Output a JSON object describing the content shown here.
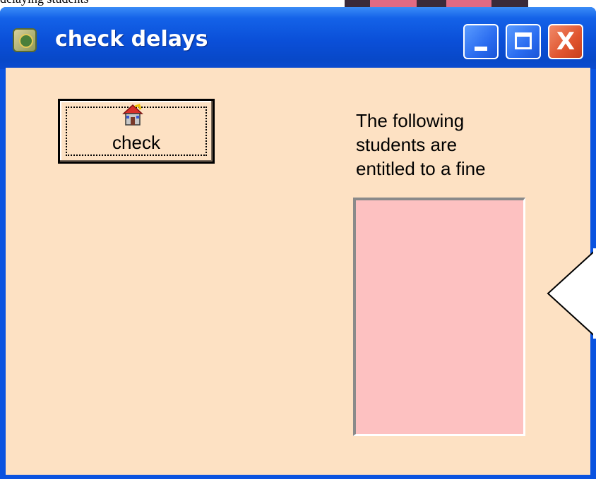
{
  "background": {
    "caption_fragment": "delaying students"
  },
  "window": {
    "title": "check delays",
    "controls": {
      "minimize": "",
      "maximize": "",
      "close": "X"
    },
    "colors": {
      "titlebar": "#0a53e0",
      "client": "#fde1c3",
      "listbox": "#fdc1c1",
      "close": "#e0542e"
    }
  },
  "form": {
    "check_button_label": "check",
    "check_button_icon": "house-icon",
    "fine_label_lines": [
      "The following",
      "students are",
      "entitled to a fine"
    ],
    "students_list": []
  }
}
